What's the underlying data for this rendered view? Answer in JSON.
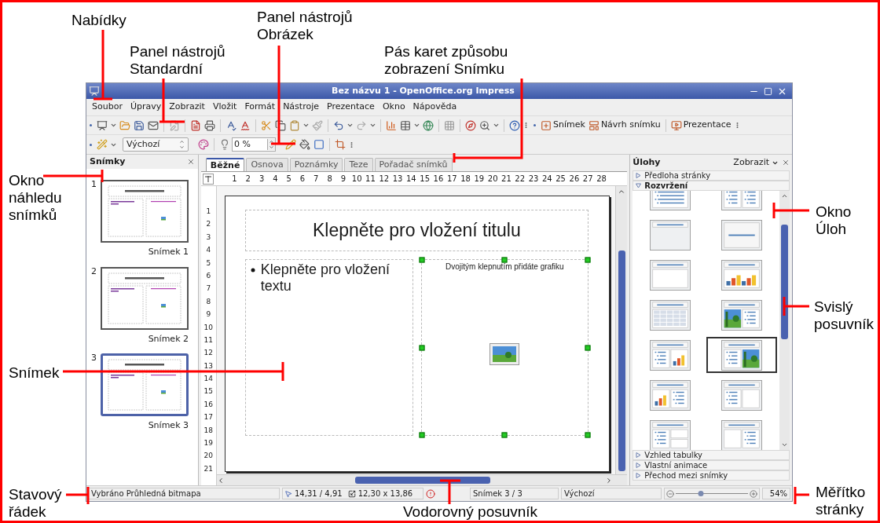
{
  "callouts": [
    {
      "text": "Nabídky"
    },
    {
      "text": "Panel nástrojů\nStandardní"
    },
    {
      "text": "Panel nástrojů\nObrázek"
    },
    {
      "text": "Pás karet způsobu\nzobrazení Snímku"
    },
    {
      "text": "Okno\nnáhledu\nsnímků"
    },
    {
      "text": "Snímek"
    },
    {
      "text": "Okno\nÚloh"
    },
    {
      "text": "Svislý\nposuvník"
    },
    {
      "text": "Stavový\nřádek"
    },
    {
      "text": "Vodorovný posuvník"
    },
    {
      "text": "Měřítko\nstránky"
    }
  ],
  "window": {
    "title": "Bez názvu 1 - OpenOffice.org Impress"
  },
  "menu": [
    "Soubor",
    "Úpravy",
    "Zobrazit",
    "Vložit",
    "Formát",
    "Nástroje",
    "Prezentace",
    "Okno",
    "Nápověda"
  ],
  "toolbar_standard": {
    "buttons": [
      "Snímek",
      "Návrh snímku",
      "Prezentace"
    ]
  },
  "toolbar_picture": {
    "filter": "Výchozí",
    "transparency": "0 %"
  },
  "slides_pane": {
    "title": "Snímky",
    "slides": [
      {
        "number": "1",
        "label": "Snímek 1",
        "selected": false
      },
      {
        "number": "2",
        "label": "Snímek 2",
        "selected": false
      },
      {
        "number": "3",
        "label": "Snímek 3",
        "selected": true
      }
    ]
  },
  "view_tabs": [
    {
      "label": "Běžné",
      "selected": true
    },
    {
      "label": "Osnova",
      "selected": false
    },
    {
      "label": "Poznámky",
      "selected": false
    },
    {
      "label": "Teze",
      "selected": false
    },
    {
      "label": "Pořadač snímků",
      "selected": false
    }
  ],
  "ruler_h": [
    "1",
    "2",
    "3",
    "4",
    "5",
    "6",
    "7",
    "8",
    "9",
    "10",
    "11",
    "12",
    "13",
    "14",
    "15",
    "16",
    "17",
    "18",
    "19",
    "20",
    "21",
    "22",
    "23",
    "24",
    "25",
    "26",
    "27",
    "28"
  ],
  "ruler_v": [
    "1",
    "2",
    "3",
    "4",
    "5",
    "6",
    "7",
    "8",
    "9",
    "10",
    "11",
    "12",
    "13",
    "14",
    "15",
    "16",
    "17",
    "18",
    "19",
    "20",
    "21"
  ],
  "slide": {
    "title": "Klepněte pro vložení titulu",
    "bullet": "Klepněte pro vložení textu",
    "graphic_hint": "Dvojitým klepnutím přidáte grafiku"
  },
  "task_pane": {
    "title": "Úlohy",
    "view_menu": "Zobrazit",
    "sections_top": [
      {
        "label": "Předloha stránky",
        "expanded": false
      },
      {
        "label": "Rozvržení",
        "expanded": true
      }
    ],
    "layouts": [
      {
        "kind": "bullets",
        "selected": false
      },
      {
        "kind": "two-bullets",
        "selected": false
      },
      {
        "kind": "title-only",
        "selected": false
      },
      {
        "kind": "centered-title",
        "selected": false
      },
      {
        "kind": "content",
        "selected": false
      },
      {
        "kind": "two-charts",
        "selected": false
      },
      {
        "kind": "table",
        "selected": false
      },
      {
        "kind": "picture-bullets",
        "selected": false
      },
      {
        "kind": "bullets-chart",
        "selected": false
      },
      {
        "kind": "bullets-picture",
        "selected": true
      },
      {
        "kind": "chart-bullets",
        "selected": false
      },
      {
        "kind": "bullets-blank",
        "selected": false
      },
      {
        "kind": "bullets-split",
        "selected": false
      },
      {
        "kind": "blank-bullets",
        "selected": false
      }
    ],
    "sections_bottom": [
      {
        "label": "Vzhled tabulky",
        "expanded": false
      },
      {
        "label": "Vlastní animace",
        "expanded": false
      },
      {
        "label": "Přechod mezi snímky",
        "expanded": false
      }
    ]
  },
  "status_bar": {
    "selection": "Vybráno Průhledná bitmapa",
    "position": "14,31 / 4,91",
    "size": "12,30 x 13,86",
    "slide": "Snímek 3 / 3",
    "master": "Výchozí",
    "zoom": {
      "level": 0.35
    },
    "zoom_value": "54%"
  }
}
